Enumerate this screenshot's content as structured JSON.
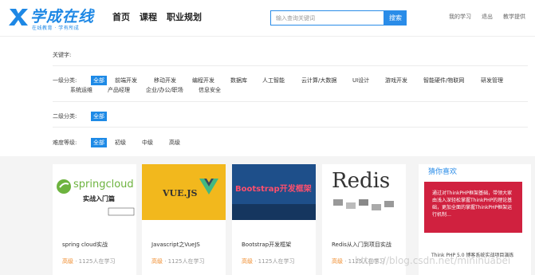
{
  "logo": {
    "brand": "学成在线",
    "slogan": "在线教育 · 学有所成"
  },
  "nav": [
    "首页",
    "课程",
    "职业规划"
  ],
  "search": {
    "placeholder": "输入查询关键词",
    "button": "搜索"
  },
  "user_links": [
    "我的学习",
    "退出",
    "教学提供"
  ],
  "filters": {
    "keyword_label": "关键字:",
    "category1_label": "一级分类:",
    "category1_items": [
      "全部",
      "前端开发",
      "移动开发",
      "编程开发",
      "数据库",
      "人工智能",
      "云计算/大数据",
      "UI设计",
      "游戏开发",
      "智能硬件/物联网",
      "研发管理",
      "系统运维",
      "产品经理",
      "企业/办公/职场",
      "信息安全"
    ],
    "category2_label": "二级分类:",
    "category2_items": [
      "全部"
    ],
    "difficulty_label": "难度等级:",
    "difficulty_items": [
      "全部",
      "初级",
      "中级",
      "高级"
    ]
  },
  "courses": [
    {
      "title": "spring cloud实战",
      "level": "高级",
      "count": " · 1125人在学习",
      "thumb_text": "springcloud",
      "thumb_sub": "实战入门篇"
    },
    {
      "title": "Javascript之VueJS",
      "level": "高级",
      "count": " · 1125人在学习",
      "thumb_text": "VUE.JS"
    },
    {
      "title": "Bootstrap开发框架",
      "level": "高级",
      "count": " · 1125人在学习",
      "thumb_text": "Bootstrap开发框架"
    },
    {
      "title": "Redis从入门到项目实战",
      "level": "高级",
      "count": " · 1125人在学习",
      "thumb_text": "Redis"
    }
  ],
  "side": {
    "title": "猜你喜欢",
    "banner": "通过对ThinkPHP框架基础，带领大家由浅入深轻松掌握ThinkPHP的理论基础，更加全面的掌握ThinkPHP框架运行机制…",
    "text": "Think PHP 5.0 博客系统实战项目演练"
  },
  "watermark": "https://blog.csdn.net/minihuabei",
  "colors": {
    "accent": "#1e88e5",
    "level": "#f08c2c",
    "banner": "#d0213f"
  }
}
